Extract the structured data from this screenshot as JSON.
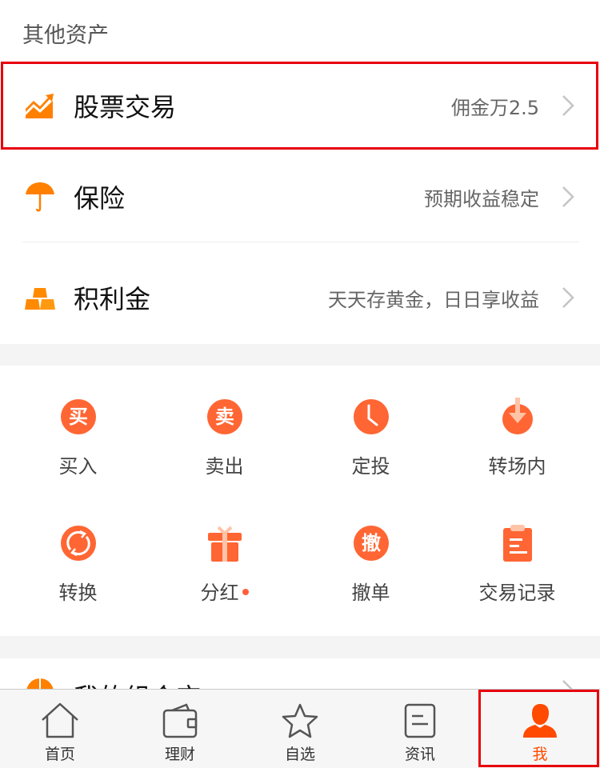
{
  "colors": {
    "accent": "#ff6633",
    "asset_icon": "#ff8000",
    "active_tab": "#ff4a00",
    "highlight": "#e8000b"
  },
  "section_title": "其他资产",
  "assets": [
    {
      "icon": "trend-chart-icon",
      "name": "股票交易",
      "desc": "佣金万2.5"
    },
    {
      "icon": "umbrella-icon",
      "name": "保险",
      "desc": "预期收益稳定"
    },
    {
      "icon": "gold-bars-icon",
      "name": "积利金",
      "desc": "天天存黄金，日日享收益"
    }
  ],
  "actions": [
    {
      "icon": "buy-icon",
      "glyph": "买",
      "label": "买入"
    },
    {
      "icon": "sell-icon",
      "glyph": "卖",
      "label": "卖出"
    },
    {
      "icon": "clock-icon",
      "label": "定投"
    },
    {
      "icon": "transfer-in-icon",
      "label": "转场内"
    },
    {
      "icon": "convert-icon",
      "label": "转换"
    },
    {
      "icon": "gift-icon",
      "label": "分红",
      "badge_dot": true
    },
    {
      "icon": "cancel-order-icon",
      "glyph": "撤",
      "label": "撤单"
    },
    {
      "icon": "clipboard-icon",
      "label": "交易记录"
    }
  ],
  "combo": {
    "icon": "pie-chart-icon",
    "name": "我的组合宝"
  },
  "tabs": [
    {
      "icon": "home-icon",
      "label": "首页"
    },
    {
      "icon": "wallet-icon",
      "label": "理财"
    },
    {
      "icon": "star-icon",
      "label": "自选"
    },
    {
      "icon": "news-icon",
      "label": "资讯"
    },
    {
      "icon": "user-icon",
      "label": "我",
      "active": true
    }
  ]
}
